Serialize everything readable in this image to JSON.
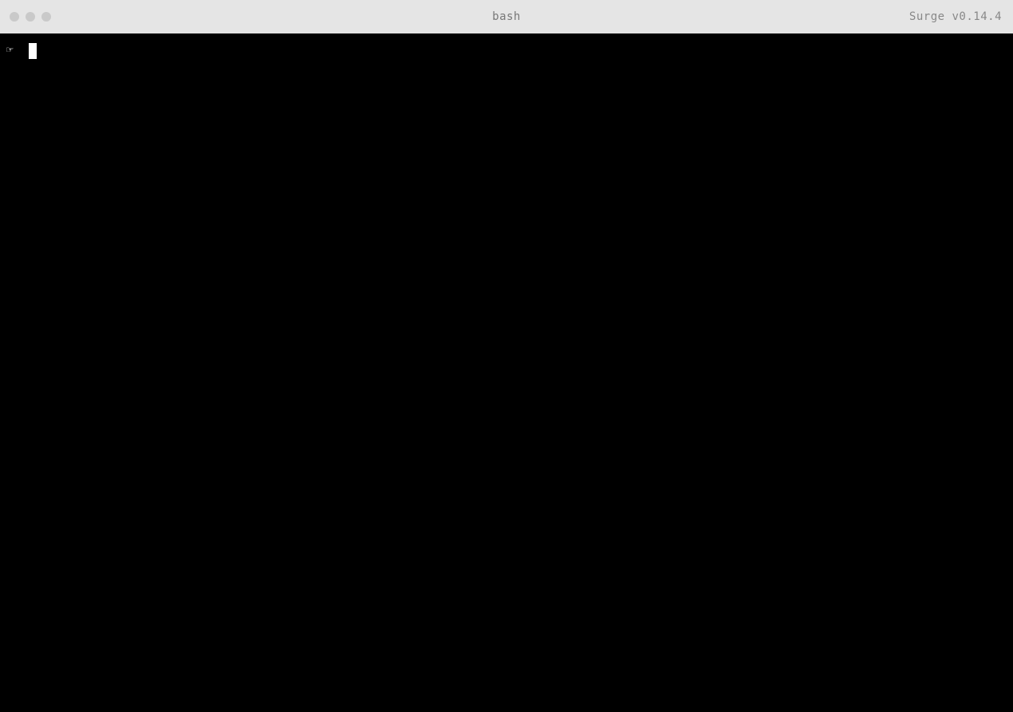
{
  "titlebar": {
    "title": "bash",
    "version": "Surge v0.14.4"
  },
  "terminal": {
    "prompt": "☞"
  }
}
